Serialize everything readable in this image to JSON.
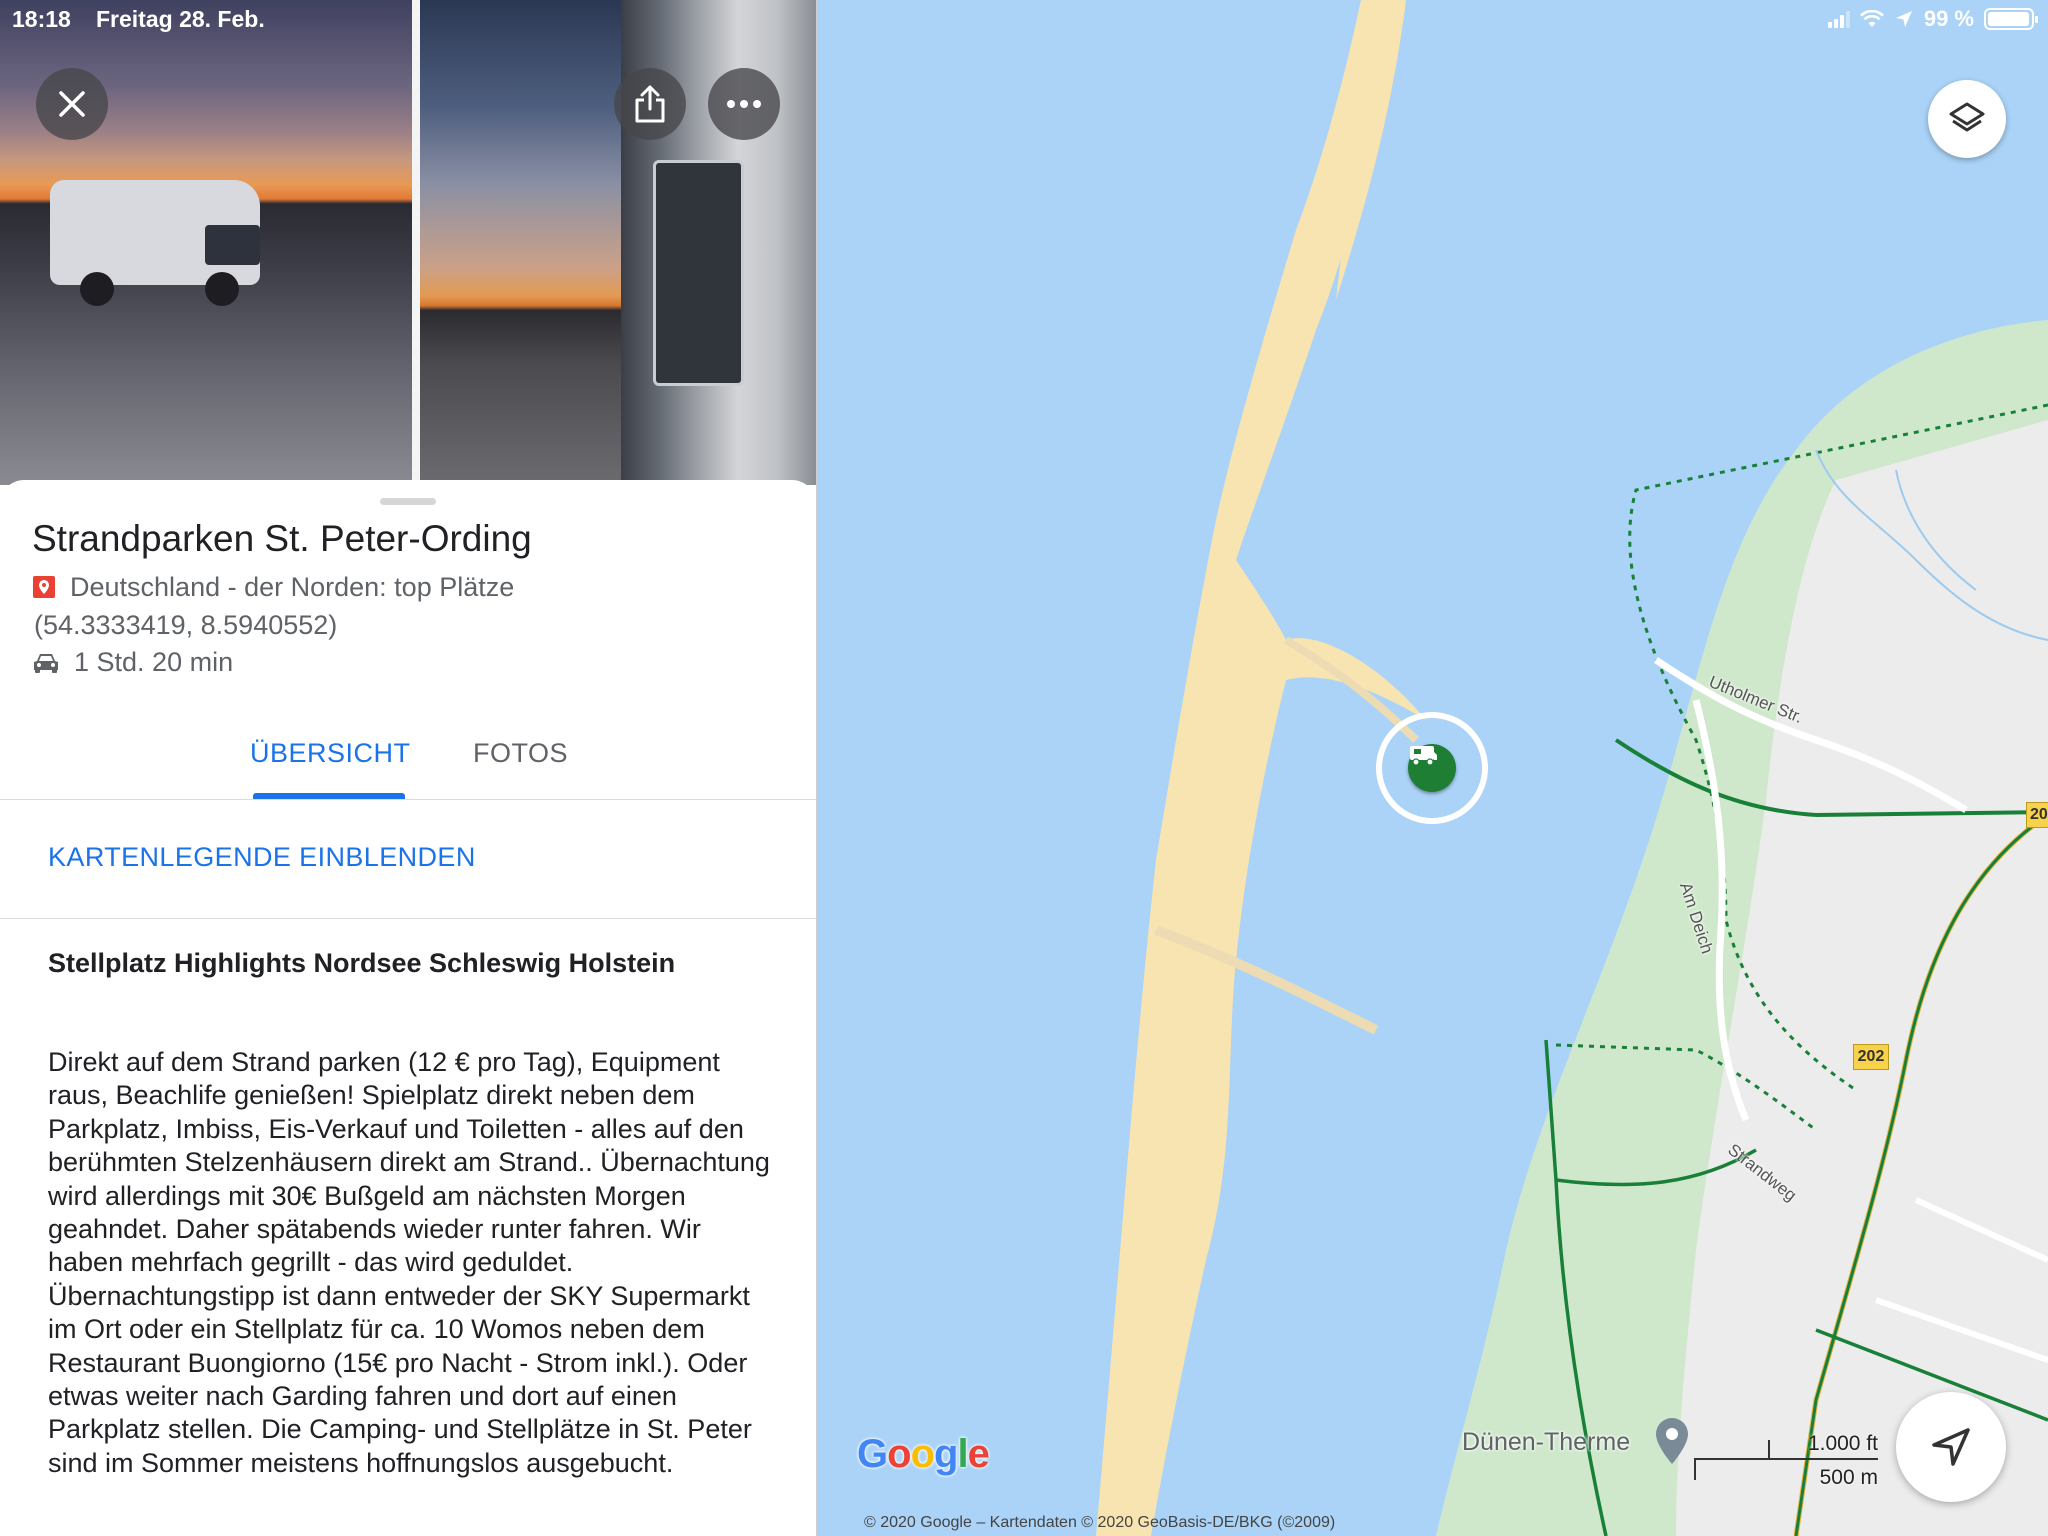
{
  "status_bar": {
    "time": "18:18",
    "date": "Freitag 28. Feb.",
    "battery": "99 %"
  },
  "place": {
    "title": "Strandparken St. Peter-Ording",
    "list_name": "Deutschland - der Norden: top Plätze",
    "coordinates": "(54.3333419, 8.5940552)",
    "drive_time": "1 Std. 20 min"
  },
  "tabs": [
    {
      "label": "ÜBERSICHT",
      "active": true
    },
    {
      "label": "FOTOS",
      "active": false
    }
  ],
  "legend_link": "KARTENLEGENDE EINBLENDEN",
  "list_title": "Stellplatz Highlights Nordsee Schleswig Holstein",
  "description": "Direkt auf dem Strand parken (12 € pro Tag), Equipment raus, Beachlife genießen! Spielplatz direkt neben dem Parkplatz, Imbiss, Eis-Verkauf und Toiletten - alles auf den berühmten Stelzenhäusern direkt am Strand.. Übernachtung wird allerdings mit 30€ Bußgeld am nächsten Morgen geahndet. Daher spätabends wieder runter fahren. Wir haben mehrfach gegrillt - das wird geduldet. Übernachtungstipp ist dann entweder der SKY Supermarkt im Ort oder ein Stellplatz für ca. 10 Womos neben dem Restaurant Buongiorno (15€ pro Nacht - Strom inkl.). Oder etwas weiter nach Garding fahren und dort auf einen Parkplatz stellen. Die Camping- und Stellplätze in St. Peter sind im Sommer meistens hoffnungslos ausgebucht.",
  "map": {
    "streets": {
      "utholmer": "Utholmer Str.",
      "am_deich": "Am Deich",
      "strandweg": "Strandweg"
    },
    "road_number": "202",
    "road_number_edge": "20",
    "poi_name": "Dünen-Therme",
    "scale_imperial": "1.000 ft",
    "scale_metric": "500 m",
    "logo": "Google",
    "copyright": "© 2020 Google – Kartendaten © 2020 GeoBasis-DE/BKG (©2009)"
  },
  "colors": {
    "accent": "#1a73e8",
    "water": "#aad3f7",
    "sand": "#f9e4b0",
    "park": "#cde8c8",
    "marker": "#1e7e34"
  }
}
